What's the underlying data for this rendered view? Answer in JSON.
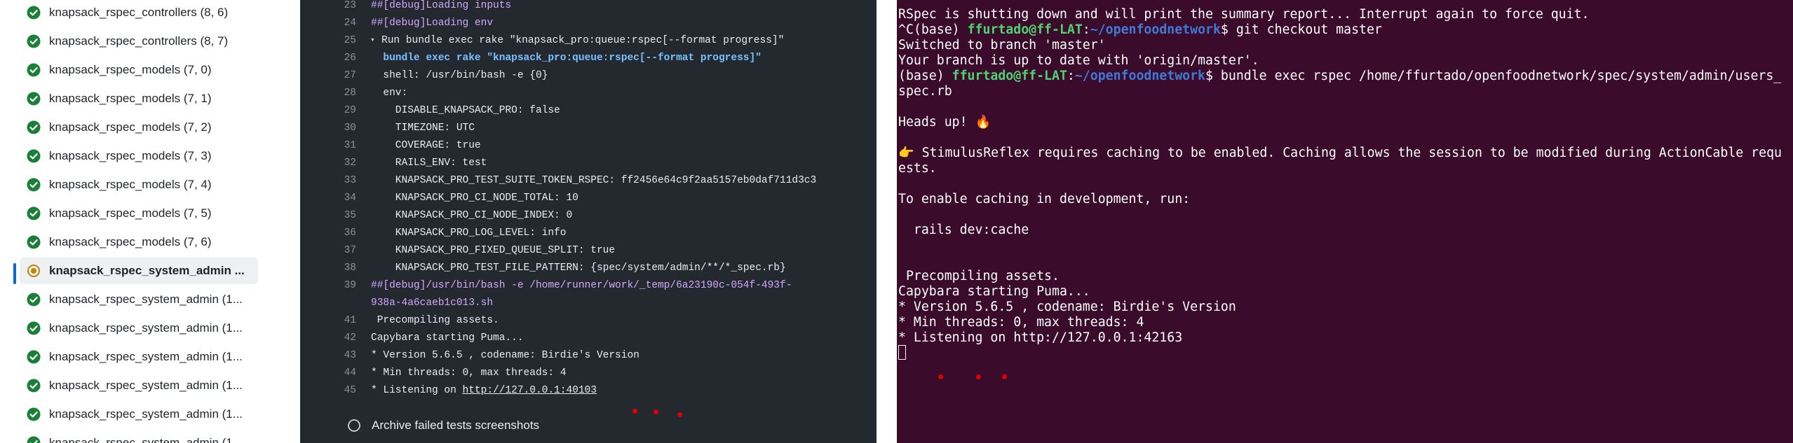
{
  "sidebar": {
    "jobs": [
      {
        "label": "knapsack_rspec_controllers (8, 6)",
        "status": "success"
      },
      {
        "label": "knapsack_rspec_controllers (8, 7)",
        "status": "success"
      },
      {
        "label": "knapsack_rspec_models (7, 0)",
        "status": "success"
      },
      {
        "label": "knapsack_rspec_models (7, 1)",
        "status": "success"
      },
      {
        "label": "knapsack_rspec_models (7, 2)",
        "status": "success"
      },
      {
        "label": "knapsack_rspec_models (7, 3)",
        "status": "success"
      },
      {
        "label": "knapsack_rspec_models (7, 4)",
        "status": "success"
      },
      {
        "label": "knapsack_rspec_models (7, 5)",
        "status": "success"
      },
      {
        "label": "knapsack_rspec_models (7, 6)",
        "status": "success"
      },
      {
        "label": "knapsack_rspec_system_admin ...",
        "status": "in-progress"
      },
      {
        "label": "knapsack_rspec_system_admin (1...",
        "status": "success"
      },
      {
        "label": "knapsack_rspec_system_admin (1...",
        "status": "success"
      },
      {
        "label": "knapsack_rspec_system_admin (1...",
        "status": "success"
      },
      {
        "label": "knapsack_rspec_system_admin (1...",
        "status": "success"
      },
      {
        "label": "knapsack_rspec_system_admin (1...",
        "status": "success"
      },
      {
        "label": "knapsack_rspec_system_admin (1...",
        "status": "success"
      }
    ],
    "colors": {
      "success": "#1a7f37",
      "in_progress": "#bf8700"
    }
  },
  "log": {
    "lines": [
      {
        "num": "23",
        "text": "##[debug]Loading inputs",
        "kind": "debug"
      },
      {
        "num": "24",
        "text": "##[debug]Loading env",
        "kind": "debug"
      },
      {
        "num": "25",
        "text": "Run bundle exec rake \"knapsack_pro:queue:rspec[--format progress]\"",
        "kind": "group"
      },
      {
        "num": "26",
        "text": "  bundle exec rake \"knapsack_pro:queue:rspec[--format progress]\"",
        "kind": "cmd"
      },
      {
        "num": "27",
        "text": "  shell: /usr/bin/bash -e {0}",
        "kind": "plain"
      },
      {
        "num": "28",
        "text": "  env:",
        "kind": "plain"
      },
      {
        "num": "29",
        "text": "    DISABLE_KNAPSACK_PRO: false",
        "kind": "plain"
      },
      {
        "num": "30",
        "text": "    TIMEZONE: UTC",
        "kind": "plain"
      },
      {
        "num": "31",
        "text": "    COVERAGE: true",
        "kind": "plain"
      },
      {
        "num": "32",
        "text": "    RAILS_ENV: test",
        "kind": "plain"
      },
      {
        "num": "33",
        "text": "    KNAPSACK_PRO_TEST_SUITE_TOKEN_RSPEC: ff2456e64c9f2aa5157eb0daf711d3c3",
        "kind": "plain"
      },
      {
        "num": "34",
        "text": "    KNAPSACK_PRO_CI_NODE_TOTAL: 10",
        "kind": "plain"
      },
      {
        "num": "35",
        "text": "    KNAPSACK_PRO_CI_NODE_INDEX: 0",
        "kind": "plain"
      },
      {
        "num": "36",
        "text": "    KNAPSACK_PRO_LOG_LEVEL: info",
        "kind": "plain"
      },
      {
        "num": "37",
        "text": "    KNAPSACK_PRO_FIXED_QUEUE_SPLIT: true",
        "kind": "plain"
      },
      {
        "num": "38",
        "text": "    KNAPSACK_PRO_TEST_FILE_PATTERN: {spec/system/admin/**/*_spec.rb}",
        "kind": "plain"
      },
      {
        "num": "39",
        "text": "##[debug]/usr/bin/bash -e /home/runner/work/_temp/6a23190c-054f-493f-",
        "kind": "debug"
      },
      {
        "num": "",
        "text": "938a-4a6caeb1c013.sh",
        "kind": "debug"
      },
      {
        "num": "41",
        "text": " Precompiling assets.",
        "kind": "plain"
      },
      {
        "num": "42",
        "text": "Capybara starting Puma...",
        "kind": "plain"
      },
      {
        "num": "43",
        "text": "* Version 5.6.5 , codename: Birdie's Version",
        "kind": "plain"
      },
      {
        "num": "44",
        "text": "* Min threads: 0, max threads: 4",
        "kind": "plain"
      },
      {
        "num": "45",
        "text": "* Listening on ",
        "kind": "link",
        "link": "http://127.0.0.1:40103"
      }
    ],
    "archive_step": "Archive failed tests screenshots",
    "colors": {
      "background": "#24292f",
      "debug": "#d2a8ff",
      "command": "#79c0ff"
    }
  },
  "terminal": {
    "lines": [
      {
        "text": "RSpec is shutting down and will print the summary report... Interrupt again to force quit."
      },
      {
        "prefix": "^C(base) ",
        "user": "ffurtado@ff-LAT",
        "sep": ":",
        "path": "~/openfoodnetwork",
        "cmd": "$ git checkout master"
      },
      {
        "text": "Switched to branch 'master'"
      },
      {
        "text": "Your branch is up to date with 'origin/master'."
      },
      {
        "prefix": "(base) ",
        "user": "ffurtado@ff-LAT",
        "sep": ":",
        "path": "~/openfoodnetwork",
        "cmd": "$ bundle exec rspec /home/ffurtado/openfoodnetwork/spec/system/admin/users_"
      },
      {
        "text": "spec.rb"
      },
      {
        "text": ""
      },
      {
        "text": "Heads up! 🔥"
      },
      {
        "text": ""
      },
      {
        "text": "👉 StimulusReflex requires caching to be enabled. Caching allows the session to be modified during ActionCable requ"
      },
      {
        "text": "ests."
      },
      {
        "text": ""
      },
      {
        "text": "To enable caching in development, run:"
      },
      {
        "text": ""
      },
      {
        "text": "  rails dev:cache"
      },
      {
        "text": ""
      },
      {
        "text": ""
      },
      {
        "text": " Precompiling assets."
      },
      {
        "text": "Capybara starting Puma..."
      },
      {
        "text": "* Version 5.6.5 , codename: Birdie's Version"
      },
      {
        "text": "* Min threads: 0, max threads: 4"
      },
      {
        "text": "* Listening on http://127.0.0.1:42163"
      }
    ],
    "colors": {
      "background": "#3b0b2c",
      "user": "#4fd26f",
      "path": "#3f7bd6"
    }
  }
}
